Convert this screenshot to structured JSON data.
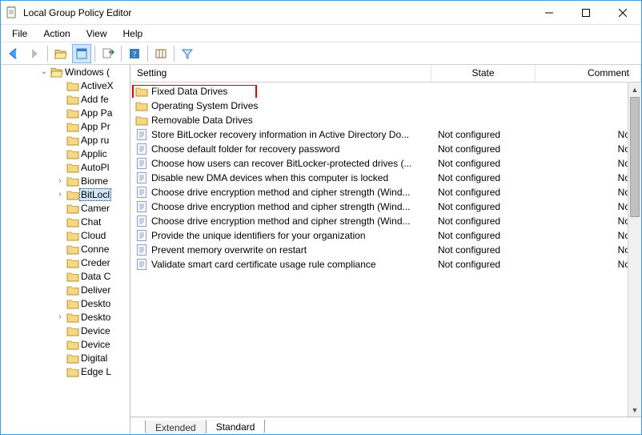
{
  "window": {
    "title": "Local Group Policy Editor"
  },
  "menu": [
    "File",
    "Action",
    "View",
    "Help"
  ],
  "tree": {
    "top": {
      "label": "Windows (",
      "expanded": true
    },
    "items": [
      {
        "label": "ActiveX",
        "twist": ""
      },
      {
        "label": "Add fe",
        "twist": ""
      },
      {
        "label": "App Pa",
        "twist": ""
      },
      {
        "label": "App Pr",
        "twist": ""
      },
      {
        "label": "App ru",
        "twist": ""
      },
      {
        "label": "Applic",
        "twist": ""
      },
      {
        "label": "AutoPl",
        "twist": ""
      },
      {
        "label": "Biome",
        "twist": ">"
      },
      {
        "label": "BitLocl",
        "twist": ">",
        "selected": true
      },
      {
        "label": "Camer",
        "twist": ""
      },
      {
        "label": "Chat",
        "twist": ""
      },
      {
        "label": "Cloud",
        "twist": ""
      },
      {
        "label": "Conne",
        "twist": ""
      },
      {
        "label": "Creder",
        "twist": ""
      },
      {
        "label": "Data C",
        "twist": ""
      },
      {
        "label": "Deliver",
        "twist": ""
      },
      {
        "label": "Deskto",
        "twist": ""
      },
      {
        "label": "Deskto",
        "twist": ">"
      },
      {
        "label": "Device",
        "twist": ""
      },
      {
        "label": "Device",
        "twist": ""
      },
      {
        "label": "Digital",
        "twist": ""
      },
      {
        "label": "Edge L",
        "twist": ""
      }
    ]
  },
  "columns": {
    "setting": "Setting",
    "state": "State",
    "comment": "Comment"
  },
  "folders": [
    {
      "name": "Fixed Data Drives",
      "highlight": true
    },
    {
      "name": "Operating System Drives"
    },
    {
      "name": "Removable Data Drives"
    }
  ],
  "policies": [
    {
      "name": "Store BitLocker recovery information in Active Directory Do...",
      "state": "Not configured",
      "comment": "No"
    },
    {
      "name": "Choose default folder for recovery password",
      "state": "Not configured",
      "comment": "No"
    },
    {
      "name": "Choose how users can recover BitLocker-protected drives (...",
      "state": "Not configured",
      "comment": "No"
    },
    {
      "name": "Disable new DMA devices when this computer is locked",
      "state": "Not configured",
      "comment": "No"
    },
    {
      "name": "Choose drive encryption method and cipher strength (Wind...",
      "state": "Not configured",
      "comment": "No"
    },
    {
      "name": "Choose drive encryption method and cipher strength (Wind...",
      "state": "Not configured",
      "comment": "No"
    },
    {
      "name": "Choose drive encryption method and cipher strength (Wind...",
      "state": "Not configured",
      "comment": "No"
    },
    {
      "name": "Provide the unique identifiers for your organization",
      "state": "Not configured",
      "comment": "No"
    },
    {
      "name": "Prevent memory overwrite on restart",
      "state": "Not configured",
      "comment": "No"
    },
    {
      "name": "Validate smart card certificate usage rule compliance",
      "state": "Not configured",
      "comment": "No"
    }
  ],
  "tabs": {
    "extended": "Extended",
    "standard": "Standard"
  }
}
